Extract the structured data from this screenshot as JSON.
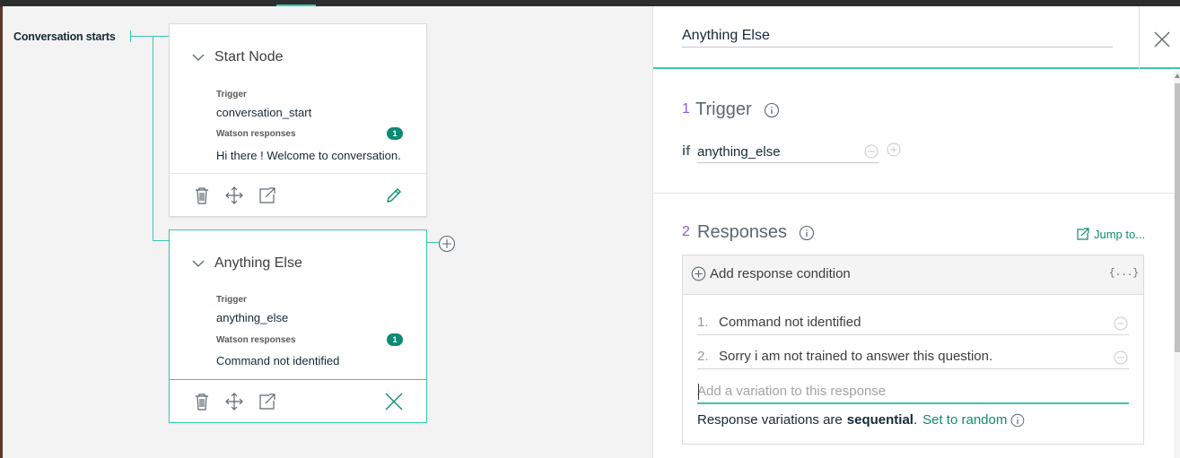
{
  "canvas": {
    "conversation_starts_label": "Conversation starts",
    "nodes": [
      {
        "title": "Start Node",
        "trigger_label": "Trigger",
        "trigger_value": "conversation_start",
        "responses_label": "Watson responses",
        "responses_count": "1",
        "response_text": "Hi there ! Welcome to conversation.",
        "selected": false
      },
      {
        "title": "Anything Else",
        "trigger_label": "Trigger",
        "trigger_value": "anything_else",
        "responses_label": "Watson responses",
        "responses_count": "1",
        "response_text": "Command not identified",
        "selected": true
      }
    ]
  },
  "panel": {
    "node_name": "Anything Else",
    "trigger": {
      "number": "1",
      "title": "Trigger",
      "if_keyword": "if",
      "condition": "anything_else"
    },
    "responses": {
      "number": "2",
      "title": "Responses",
      "jump_to": "Jump to...",
      "add_condition": "Add response condition",
      "json_icon": "{...}",
      "items": [
        {
          "index": "1.",
          "text": "Command not identified"
        },
        {
          "index": "2.",
          "text": "Sorry i am not trained to answer this question."
        }
      ],
      "variation_placeholder": "Add a variation to this response",
      "variation_prefix": "Response variations are",
      "variation_mode": "sequential",
      "variation_mode_suffix": ".",
      "set_random": "Set to random"
    }
  },
  "colors": {
    "accent": "#3ac7b0",
    "badge": "#0e8a72",
    "section_number": "#8c5cd0",
    "topbar": "#2d2d2d"
  }
}
